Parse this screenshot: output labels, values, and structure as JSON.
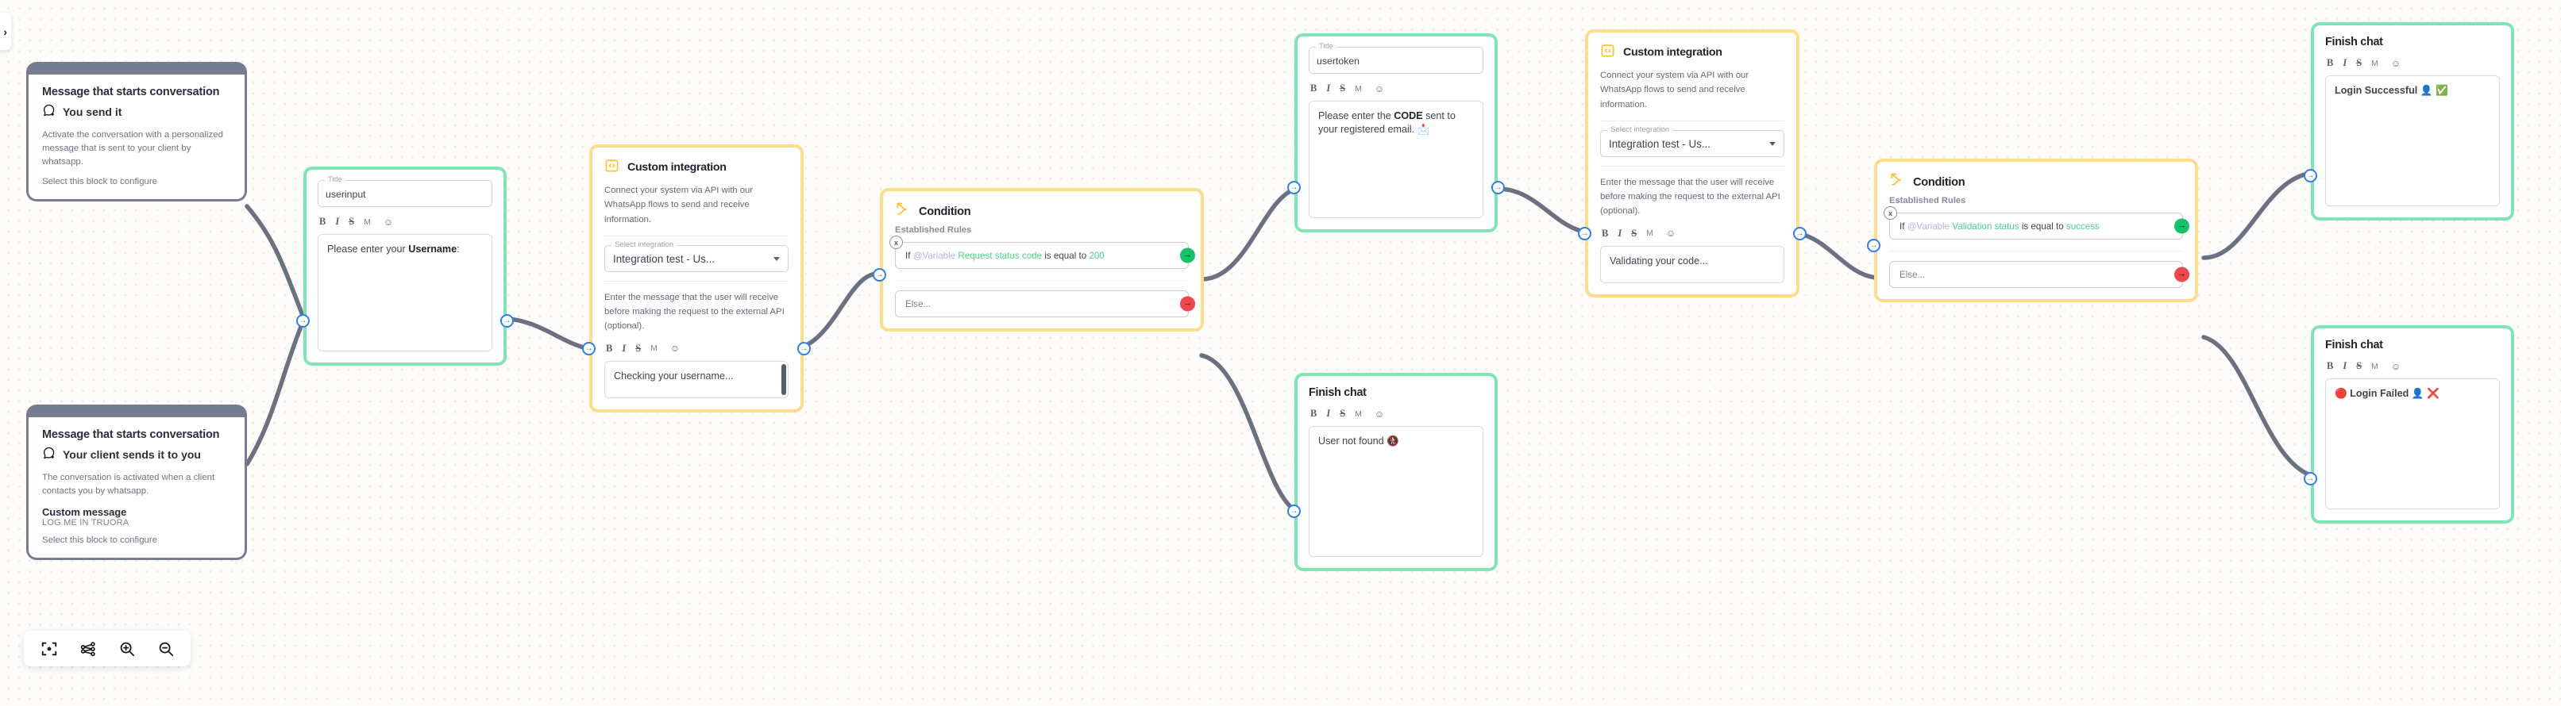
{
  "toolbar": {
    "fit_view_label": "fit-view",
    "graph_label": "share-graph",
    "zoom_in_label": "zoom-in",
    "zoom_out_label": "zoom-out"
  },
  "sidebar": {
    "toggle_label": "›"
  },
  "rich_text_toolbar": {
    "bold": "B",
    "italic": "I",
    "strike": "S",
    "markdown": "M",
    "emoji": "☺"
  },
  "colors": {
    "green_accent": "#7fe5b4",
    "yellow_accent": "#fcdd8a",
    "slate_accent": "#777d90",
    "handle_blue": "#2f7df6",
    "success_green": "#15c26a",
    "error_red": "#f0474d",
    "variable_purple": "#b0b6f0",
    "value_green": "#4cd08a",
    "canvas_bg": "#fdfcfa"
  },
  "nodes": {
    "start_you_send": {
      "title": "Message that starts conversation",
      "subtitle": "You send it",
      "icon": "whatsapp-send-icon",
      "description": "Activate the conversation with a personalized message that is sent to your client by whatsapp.",
      "footer": "Select this block to configure"
    },
    "start_client_sends": {
      "title": "Message that starts conversation",
      "subtitle": "Your client sends it to you",
      "icon": "whatsapp-receive-icon",
      "description": "The conversation is activated when a client contacts you by whatsapp.",
      "custom_message_label": "Custom message",
      "custom_message_value": "LOG ME IN TRUORA",
      "footer": "Select this block to configure"
    },
    "userinput": {
      "title_legend": "Title",
      "title_value": "userinput",
      "message_prefix": "Please enter your ",
      "message_bold": "Username",
      "message_suffix": ":"
    },
    "integration_1": {
      "icon": "code-brackets-icon",
      "title": "Custom integration",
      "description": "Connect your system via API with our WhatsApp flows to send and receive information.",
      "select_legend": "Select integration",
      "select_value": "Integration test - Us...",
      "message_help": "Enter the message that the user will receive before making the request to the external API (optional).",
      "message_value": "Checking your username..."
    },
    "condition_1": {
      "icon": "condition-branch-icon",
      "title": "Condition",
      "rules_label": "Established Rules",
      "rule": {
        "if": "If",
        "variable": "@Variable",
        "field": "Request status code",
        "operator": "is equal to",
        "value": "200",
        "remove_badge": "x"
      },
      "else_placeholder": "Else..."
    },
    "usertoken": {
      "title_legend": "Title",
      "title_value": "usertoken",
      "message_prefix": "Please enter the ",
      "message_bold": "CODE",
      "message_suffix": " sent to your registered email. 📩"
    },
    "finish_user_not_found": {
      "title": "Finish chat",
      "message_value": "User not found 🚷"
    },
    "integration_2": {
      "icon": "code-brackets-icon",
      "title": "Custom integration",
      "description": "Connect your system via API with our WhatsApp flows to send and receive information.",
      "select_legend": "Select integration",
      "select_value": "Integration test - Us...",
      "message_help": "Enter the message that the user will receive before making the request to the external API (optional).",
      "message_value": "Validating your code..."
    },
    "condition_2": {
      "icon": "condition-branch-icon",
      "title": "Condition",
      "rules_label": "Established Rules",
      "rule": {
        "if": "If",
        "variable": "@Variable",
        "field": "Validation status",
        "operator": "is equal to",
        "value": "success",
        "remove_badge": "x"
      },
      "else_placeholder": "Else..."
    },
    "finish_login_successful": {
      "title": "Finish chat",
      "message_value": "Login Successful 👤 ✅"
    },
    "finish_login_failed": {
      "title": "Finish chat",
      "message_value": "🔴 Login Failed 👤 ❌"
    }
  }
}
